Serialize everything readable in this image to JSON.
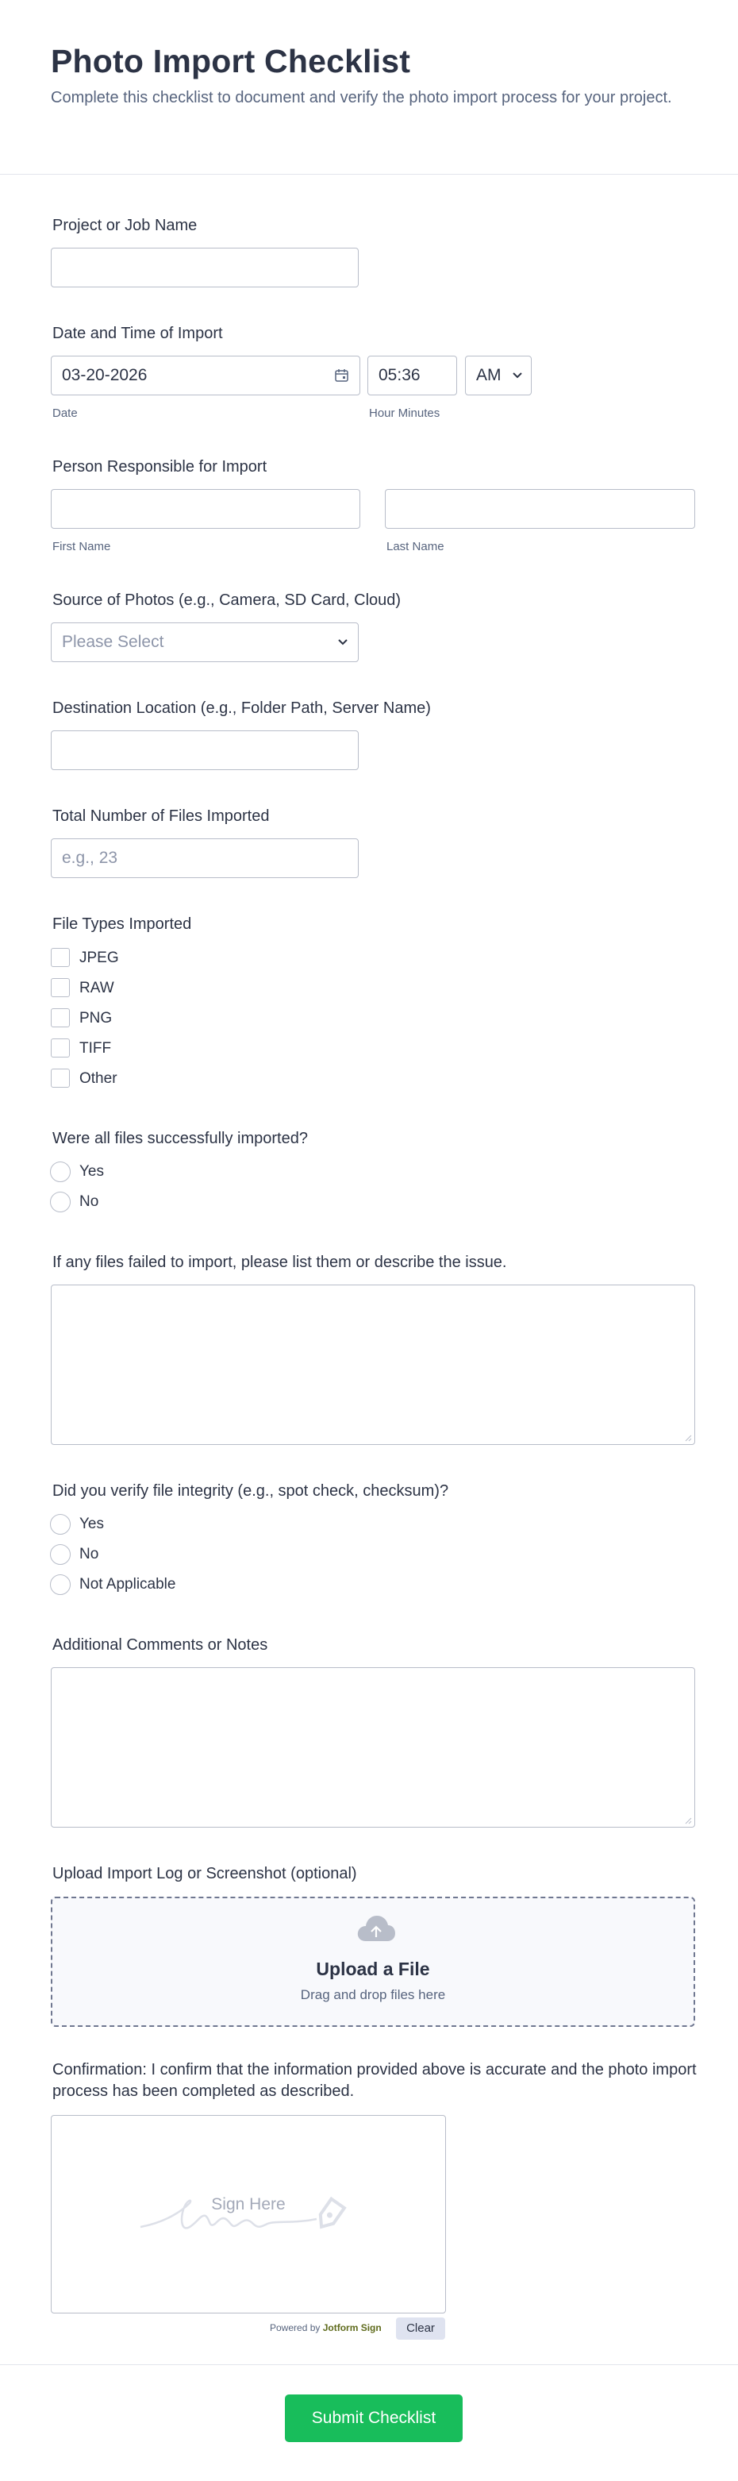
{
  "header": {
    "title": "Photo Import Checklist",
    "subtitle": "Complete this checklist to document and verify the photo import process for your project."
  },
  "fields": {
    "project_name": {
      "label": "Project or Job Name",
      "value": ""
    },
    "datetime": {
      "label": "Date and Time of Import",
      "date_value": "03-20-2026",
      "date_sublabel": "Date",
      "time_value": "05:36",
      "time_sublabel": "Hour Minutes",
      "ampm_value": "AM"
    },
    "person": {
      "label": "Person Responsible for Import",
      "first_sublabel": "First Name",
      "last_sublabel": "Last Name"
    },
    "source": {
      "label": "Source of Photos (e.g., Camera, SD Card, Cloud)",
      "placeholder": "Please Select"
    },
    "destination": {
      "label": "Destination Location (e.g., Folder Path, Server Name)"
    },
    "total_files": {
      "label": "Total Number of Files Imported",
      "placeholder": "e.g., 23"
    },
    "file_types": {
      "label": "File Types Imported",
      "options": [
        "JPEG",
        "RAW",
        "PNG",
        "TIFF",
        "Other"
      ]
    },
    "success": {
      "label": "Were all files successfully imported?",
      "options": [
        "Yes",
        "No"
      ]
    },
    "failures": {
      "label": "If any files failed to import, please list them or describe the issue."
    },
    "integrity": {
      "label": "Did you verify file integrity (e.g., spot check, checksum)?",
      "options": [
        "Yes",
        "No",
        "Not Applicable"
      ]
    },
    "comments": {
      "label": "Additional Comments or Notes"
    },
    "upload": {
      "label": "Upload Import Log or Screenshot (optional)",
      "title": "Upload a File",
      "hint": "Drag and drop files here"
    },
    "confirmation": {
      "label": "Confirmation: I confirm that the information provided above is accurate and the photo import process has been completed as described.",
      "sign_here": "Sign Here",
      "powered_by": "Powered by",
      "brand": "Jotform Sign",
      "clear": "Clear"
    }
  },
  "submit_label": "Submit Checklist",
  "colors": {
    "accent": "#18bd5b",
    "text": "#2c3345",
    "muted": "#57647e",
    "border": "#b8bdc9"
  }
}
